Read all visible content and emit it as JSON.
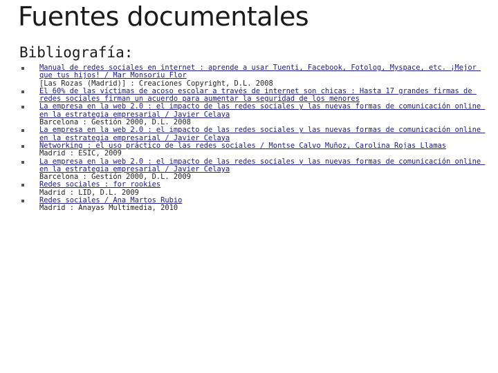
{
  "title": "Fuentes documentales",
  "subtitle": "Bibliografía:",
  "entries": [
    {
      "title": "Manual de redes sociales en internet : aprende a usar Tuenti, Facebook, Fotolog, Myspace, etc. ¡Mejor que tus hijos! / Mar Monsoriu Flor",
      "imprint": "[Las Rozas (Madrid)] : Creaciones Copyright, D.L. 2008"
    },
    {
      "title": "El 60% de las víctimas de acoso escolar a través de internet son chicas : Hasta 17 grandes firmas de redes sociales firman un acuerdo para aumentar la seguridad de los menores",
      "imprint": ""
    },
    {
      "title": "La empresa en la web 2.0 : el impacto de las redes sociales y las nuevas formas de comunicación online en la estrategia empresarial / Javier Celaya",
      "imprint": "Barcelona : Gestión 2000, D.L. 2008"
    },
    {
      "title": "La empresa en la web 2.0 : el impacto de las redes sociales y las nuevas formas de comunicación online en la estrategia empresarial / Javier Celaya",
      "imprint": ""
    },
    {
      "title": "Networking : el uso práctico de las redes sociales / Montse Calvo Muñoz, Carolina Rojas Llamas",
      "imprint": "Madrid : ESIC, 2009"
    },
    {
      "title": "La empresa en la web 2.0 : el impacto de las redes sociales y las nuevas formas de comunicación online en la estrategia empresarial / Javier Celaya",
      "imprint": "Barcelona : Gestión 2000, D.L. 2009"
    },
    {
      "title": "Redes sociales : for rookies",
      "imprint": "Madrid : LID, D.L. 2009"
    },
    {
      "title": "Redes sociales / Ana Martos Rubio",
      "imprint": "Madrid : Anayas Multimedia, 2010"
    }
  ],
  "colors": {
    "link": "#1a1a8a",
    "text": "#1a1a1a",
    "bullet": "#555555"
  }
}
